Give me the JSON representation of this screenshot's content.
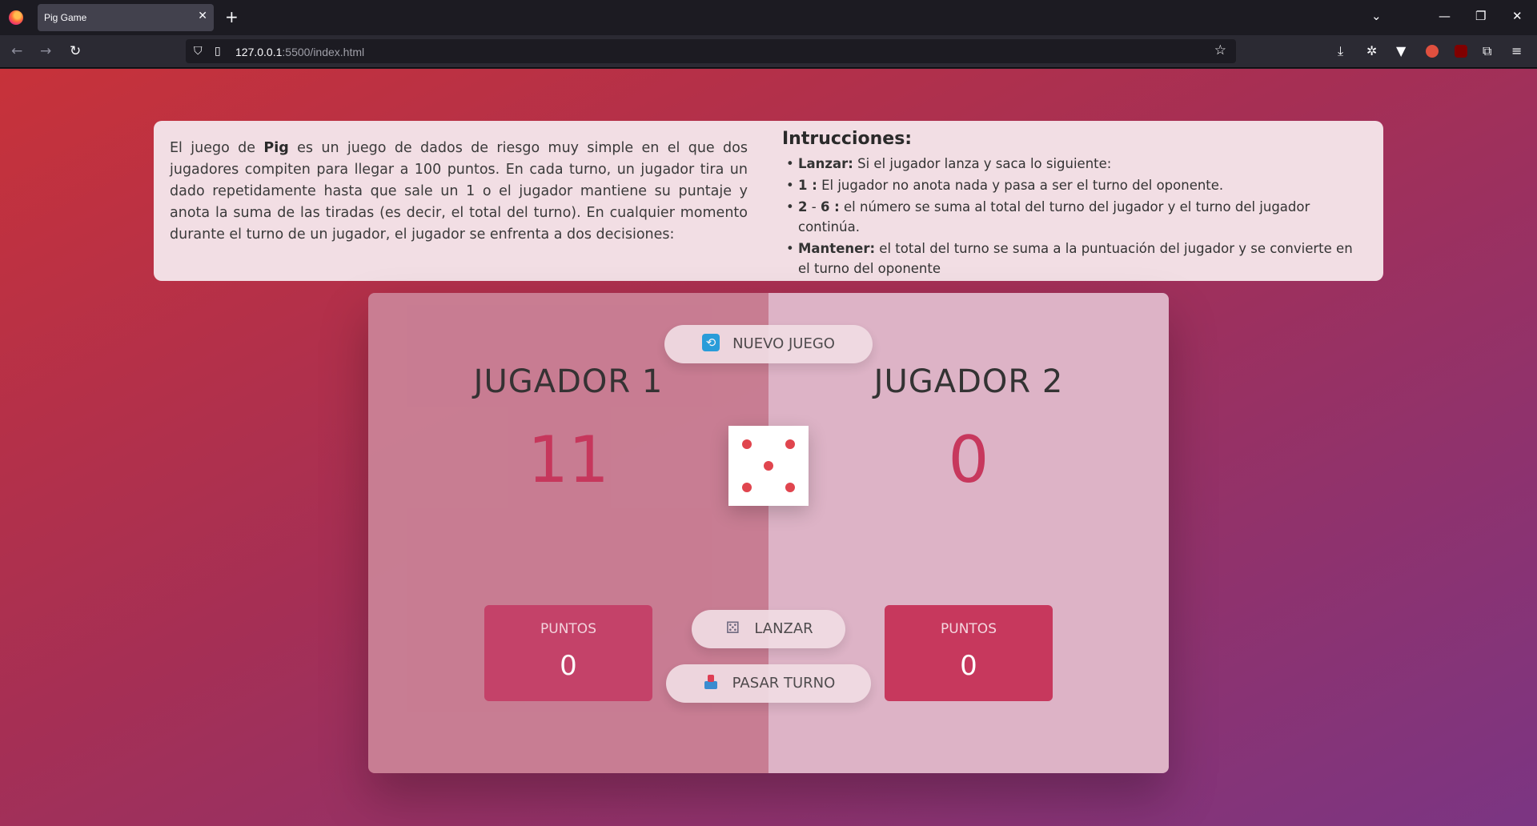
{
  "browser": {
    "tab_title": "Pig Game",
    "tab_close": "✕",
    "new_tab": "+",
    "url_host": "127.0.0.1",
    "url_rest": ":5500/index.html",
    "icons": [
      "firefox-logo",
      "list-all-tabs",
      "minimize",
      "restore",
      "close",
      "back",
      "forward",
      "reload",
      "shield",
      "page-info",
      "bookmark-star",
      "downloads",
      "extension",
      "vpn",
      "extension",
      "ublock-origin",
      "extensions",
      "menu"
    ]
  },
  "info": {
    "intro_1": "El juego de ",
    "intro_bold": "Pig",
    "intro_2": " es un juego de dados de riesgo muy simple en el que dos jugadores compiten para llegar a 100 puntos. En cada turno, un jugador tira un dado repetidamente hasta que sale un 1 o el jugador mantiene su puntaje y anota la suma de las tiradas (es decir, el total del turno). En cualquier momento durante el turno de un jugador, el jugador se enfrenta a dos decisiones:",
    "title": "Intrucciones:",
    "items": [
      {
        "bold": "Lanzar:",
        "text": " Si el jugador lanza y saca lo siguiente:"
      },
      {
        "bold": "1 :",
        "text": " El jugador no anota nada y pasa a ser el turno del oponente."
      },
      {
        "bold": "2",
        "mid": " - ",
        "bold2": "6 :",
        "text": " el número se suma al total del turno del jugador y el turno del jugador continúa."
      },
      {
        "bold": "Mantener:",
        "text": " el total del turno se suma a la puntuación del jugador y se convierte en el turno del oponente"
      }
    ]
  },
  "game": {
    "new_game": "NUEVO JUEGO",
    "roll": "LANZAR",
    "hold": "PASAR TURNO",
    "dice_value": 5,
    "players": [
      {
        "name": "JUGADOR 1",
        "score": "11",
        "current_label": "PUNTOS",
        "current": "0"
      },
      {
        "name": "JUGADOR 2",
        "score": "0",
        "current_label": "PUNTOS",
        "current": "0"
      }
    ]
  },
  "colors": {
    "accent": "#c7385d",
    "dice_pip": "#e0454e"
  }
}
